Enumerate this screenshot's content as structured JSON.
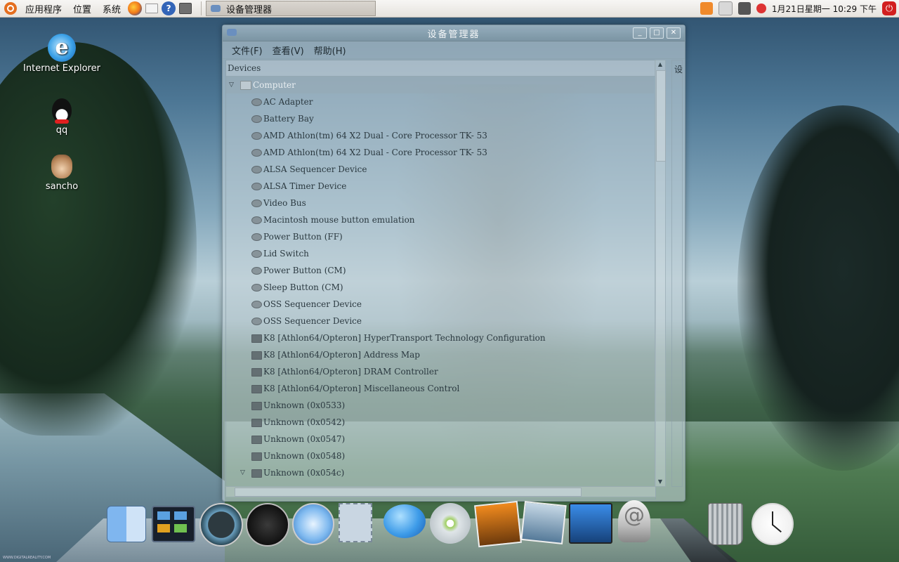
{
  "top_panel": {
    "menus": [
      "应用程序",
      "位置",
      "系统"
    ],
    "launchers": [
      "firefox-icon",
      "mail-icon",
      "help-icon",
      "screenshot-icon"
    ],
    "task": {
      "label": "设备管理器",
      "icon": "device-manager-icon"
    },
    "tray": [
      "update-manager-icon",
      "printer-icon",
      "network-icon",
      "volume-icon"
    ],
    "clock": "1月21日星期一 10:29 下午",
    "power_icon": "power-icon"
  },
  "desktop_icons": [
    {
      "label": "Internet Explorer",
      "icon": "internet-explorer-icon"
    },
    {
      "label": "qq",
      "icon": "qq-penguin-icon"
    },
    {
      "label": "sancho",
      "icon": "sancho-icon"
    }
  ],
  "window": {
    "title": "设备管理器",
    "controls": [
      "minimize",
      "maximize",
      "close"
    ],
    "menu": [
      "文件(F)",
      "查看(V)",
      "帮助(H)"
    ],
    "tree_header": "Devices",
    "side_header": "设",
    "root": "Computer",
    "devices": [
      {
        "label": "AC Adapter",
        "icon": "device-icon"
      },
      {
        "label": "Battery Bay",
        "icon": "device-icon"
      },
      {
        "label": "AMD Athlon(tm) 64 X2 Dual - Core Processor TK- 53",
        "icon": "device-icon"
      },
      {
        "label": "AMD Athlon(tm) 64 X2 Dual - Core Processor TK- 53",
        "icon": "device-icon"
      },
      {
        "label": "ALSA Sequencer Device",
        "icon": "device-icon"
      },
      {
        "label": "ALSA Timer Device",
        "icon": "device-icon"
      },
      {
        "label": "Video Bus",
        "icon": "device-icon"
      },
      {
        "label": "Macintosh mouse button emulation",
        "icon": "device-icon"
      },
      {
        "label": "Power Button (FF)",
        "icon": "device-icon"
      },
      {
        "label": "Lid Switch",
        "icon": "device-icon"
      },
      {
        "label": "Power Button (CM)",
        "icon": "device-icon"
      },
      {
        "label": "Sleep Button (CM)",
        "icon": "device-icon"
      },
      {
        "label": "OSS Sequencer Device",
        "icon": "device-icon"
      },
      {
        "label": "OSS Sequencer Device",
        "icon": "device-icon"
      },
      {
        "label": "K8 [Athlon64/Opteron] HyperTransport Technology Configuration",
        "icon": "chip-icon"
      },
      {
        "label": "K8 [Athlon64/Opteron] Address Map",
        "icon": "chip-icon"
      },
      {
        "label": "K8 [Athlon64/Opteron] DRAM Controller",
        "icon": "chip-icon"
      },
      {
        "label": "K8 [Athlon64/Opteron] Miscellaneous Control",
        "icon": "chip-icon"
      },
      {
        "label": "Unknown (0x0533)",
        "icon": "chip-icon"
      },
      {
        "label": "Unknown (0x0542)",
        "icon": "chip-icon"
      },
      {
        "label": "Unknown (0x0547)",
        "icon": "chip-icon"
      },
      {
        "label": "Unknown (0x0548)",
        "icon": "chip-icon"
      },
      {
        "label": "Unknown (0x054c)",
        "icon": "chip-icon",
        "expanded": true
      }
    ]
  },
  "dock": {
    "items": [
      "finder-icon",
      "expose-icon",
      "time-machine-icon",
      "dashboard-icon",
      "safari-icon",
      "mail-stamp-icon",
      "ichat-icon",
      "itunes-icon",
      "iphoto-icon",
      "photo-booth-icon",
      "imovie-icon",
      "at-mail-icon",
      "trash-icon",
      "clock-icon"
    ]
  },
  "watermark": "WWW.DIGITALREALITY.COM"
}
